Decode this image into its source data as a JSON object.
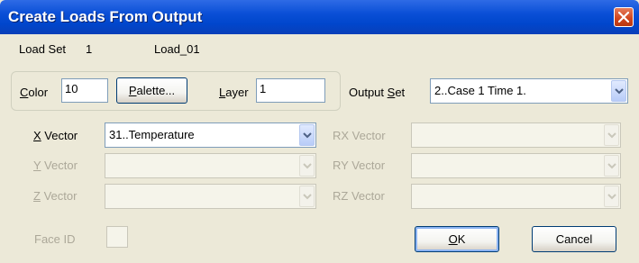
{
  "window": {
    "title": "Create Loads From Output",
    "close_icon": "close-icon"
  },
  "load_set": {
    "label": "Load Set",
    "number": "1",
    "name": "Load_01"
  },
  "color": {
    "label_mnemonic": "C",
    "label_rest": "olor",
    "value": "10"
  },
  "palette_button": {
    "mnemonic": "P",
    "rest": "alette..."
  },
  "layer": {
    "label_mnemonic": "L",
    "label_rest": "ayer",
    "value": "1"
  },
  "output_set": {
    "label_before": "Output ",
    "label_mnemonic": "S",
    "label_rest": "et",
    "value": "2..Case 1 Time 1."
  },
  "x_vector": {
    "label_mnemonic": "X",
    "label_rest": " Vector",
    "value": "31..Temperature"
  },
  "y_vector": {
    "label_mnemonic": "Y",
    "label_rest": " Vector",
    "value": ""
  },
  "z_vector": {
    "label_mnemonic": "Z",
    "label_rest": " Vector",
    "value": ""
  },
  "rx_vector": {
    "label": "RX Vector",
    "value": ""
  },
  "ry_vector": {
    "label": "RY Vector",
    "value": ""
  },
  "rz_vector": {
    "label": "RZ Vector",
    "value": ""
  },
  "face_id": {
    "label": "Face ID"
  },
  "ok_button": {
    "mnemonic": "O",
    "rest": "K"
  },
  "cancel_button": {
    "label": "Cancel"
  },
  "colors": {
    "title_bar": "#0046CC",
    "dialog_bg": "#ECE9D8",
    "close_button": "#D0441C",
    "disabled_text": "#ACA899"
  }
}
